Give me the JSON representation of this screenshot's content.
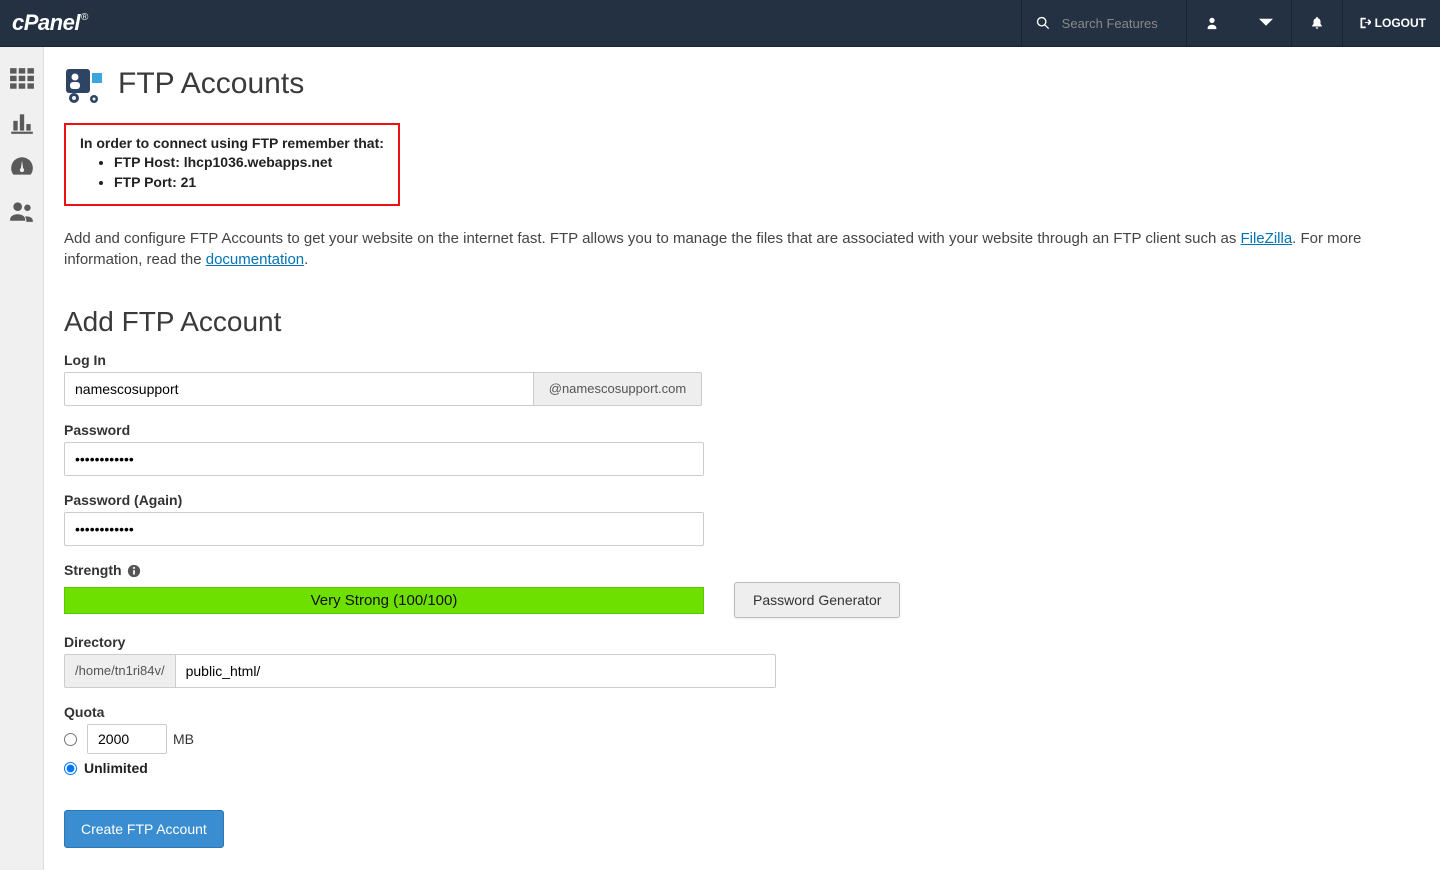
{
  "header": {
    "logo_text": "cPanel",
    "search_placeholder": "Search Features",
    "logout_label": "LOGOUT"
  },
  "page": {
    "title": "FTP Accounts",
    "info_title": "In order to connect using FTP remember that:",
    "info_host": "FTP Host: lhcp1036.webapps.net",
    "info_port": "FTP Port: 21",
    "intro_pre": "Add and configure FTP Accounts to get your website on the internet fast. FTP allows you to manage the files that are associated with your website through an FTP client such as ",
    "intro_link1": "FileZilla",
    "intro_mid": ". For more information, read the ",
    "intro_link2": "documentation",
    "intro_post": "."
  },
  "form": {
    "section_title": "Add FTP Account",
    "login_label": "Log In",
    "login_value": "namescosupport",
    "login_domain": "@namescosupport.com",
    "password_label": "Password",
    "password_value": "●●●●●●●●●●●●",
    "password2_label": "Password (Again)",
    "password2_value": "●●●●●●●●●●●●",
    "strength_label": "Strength",
    "strength_text": "Very Strong (100/100)",
    "generator_label": "Password Generator",
    "directory_label": "Directory",
    "directory_prefix": "/home/tn1ri84v/",
    "directory_value": "public_html/",
    "quota_label": "Quota",
    "quota_value": "2000",
    "quota_unit": "MB",
    "unlimited_label": "Unlimited",
    "submit_label": "Create FTP Account"
  }
}
